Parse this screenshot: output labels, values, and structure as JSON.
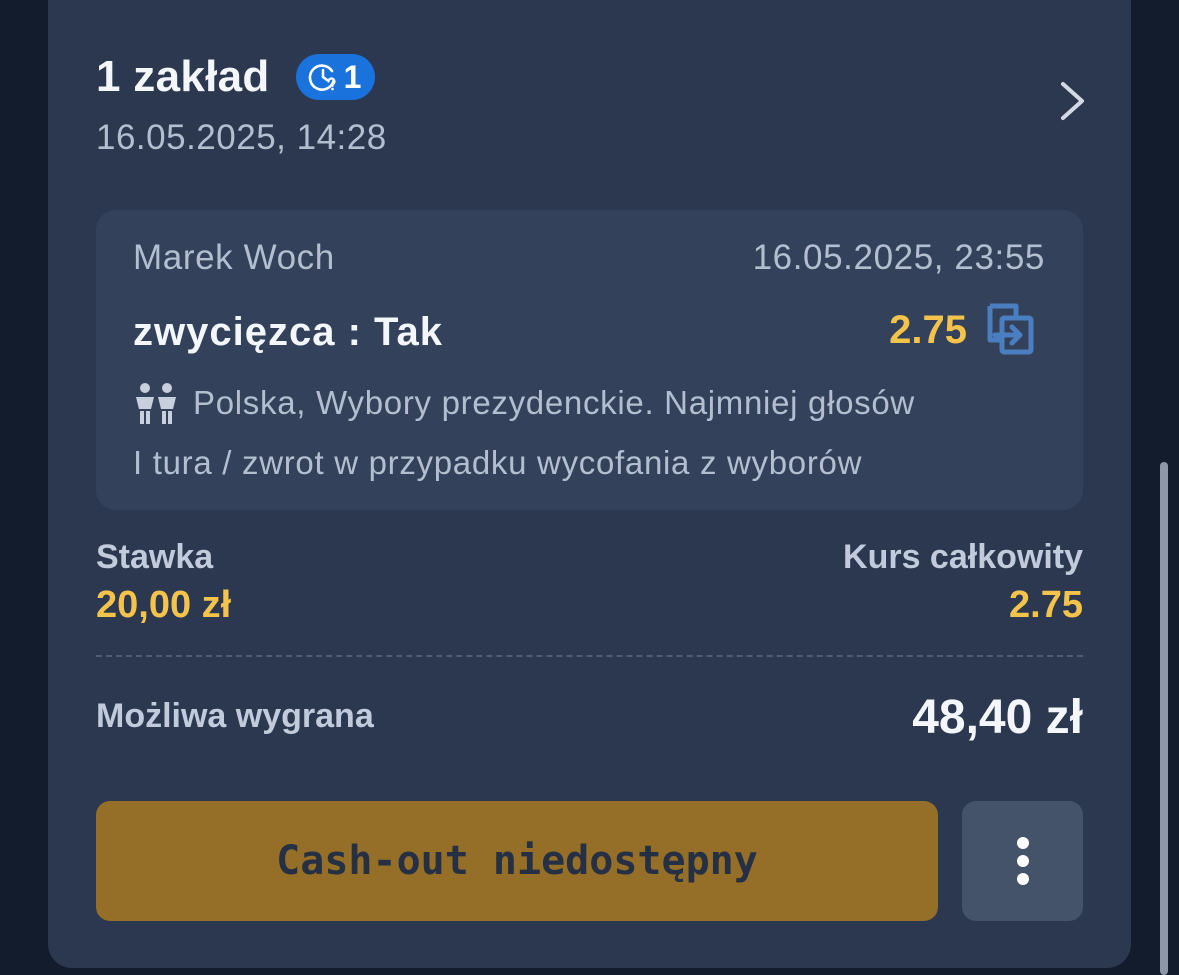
{
  "bet": {
    "title": "1 zakład",
    "pending_count": "1",
    "placed_date": "16.05.2025, 14:28"
  },
  "selection": {
    "name": "Marek Woch",
    "event_date": "16.05.2025, 23:55",
    "pick": "zwycięzca : Tak",
    "odds": "2.75",
    "event": "Polska, Wybory prezydenckie. Najmniej głosów",
    "market": "I tura / zwrot w przypadku wycofania z wyborów"
  },
  "summary": {
    "stake_label": "Stawka",
    "stake_value": "20,00 zł",
    "total_odds_label": "Kurs całkowity",
    "total_odds_value": "2.75",
    "potential_win_label": "Możliwa wygrana",
    "potential_win_value": "48,40 zł"
  },
  "actions": {
    "cashout_label": "Cash-out niedostępny"
  },
  "icons": {
    "pending": "clock-question-icon",
    "details": "chevron-right-icon",
    "swap": "swap-selection-icon",
    "event": "people-icon",
    "more": "more-vertical-icon"
  },
  "colors": {
    "background": "#131c2c",
    "card": "#2b3850",
    "selection_box": "#33415a",
    "odds_accent": "#f4c34b",
    "badge": "#1a72dc",
    "cashout_button": "#956f27"
  }
}
